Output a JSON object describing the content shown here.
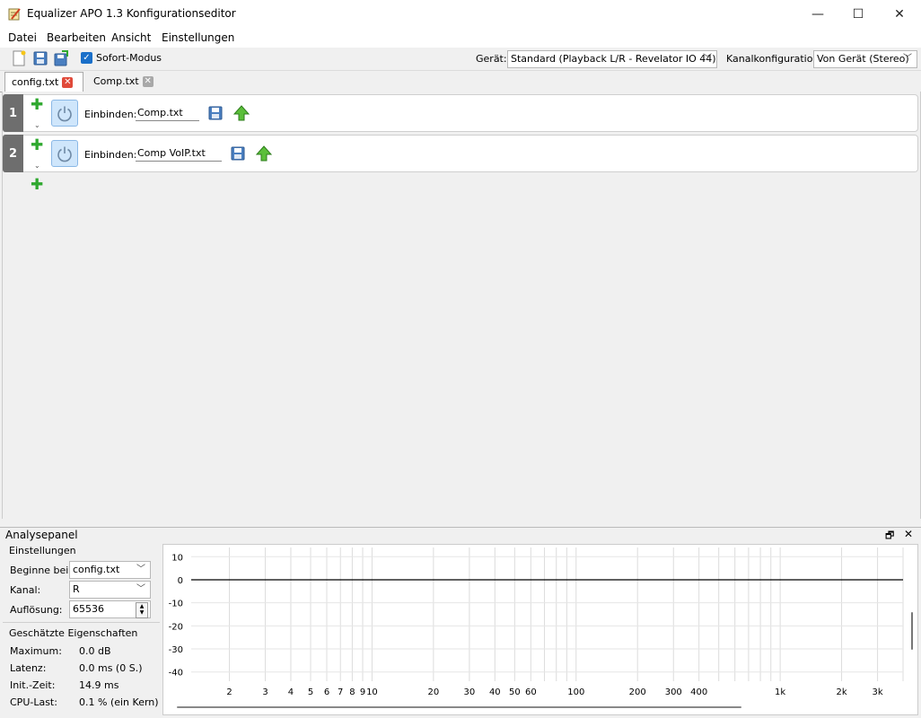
{
  "window": {
    "title": "Equalizer APO 1.3 Konfigurationseditor",
    "minimize_glyph": "—",
    "maximize_glyph": "☐",
    "close_glyph": "✕"
  },
  "menu": [
    "Datei",
    "Bearbeiten",
    "Ansicht",
    "Einstellungen"
  ],
  "toolbar": {
    "icons": [
      "new-file-icon",
      "save-icon",
      "save-all-icon"
    ],
    "instant_mode_label": "Sofort-Modus",
    "instant_mode_checked": true,
    "device_label": "Gerät:",
    "device_value": "Standard (Playback L/R - Revelator IO 44)",
    "channel_config_label": "Kanalkonfiguration:",
    "channel_config_value": "Von Gerät (Stereo)"
  },
  "tabs": [
    {
      "label": "config.txt",
      "active": true
    },
    {
      "label": "Comp.txt",
      "active": false
    }
  ],
  "filters": [
    {
      "number": "1",
      "include_label": "Einbinden:",
      "file": "Comp.txt"
    },
    {
      "number": "2",
      "include_label": "Einbinden:",
      "file": "Comp VoIP.txt"
    }
  ],
  "analysis": {
    "title": "Analysepanel",
    "settings_group": "Einstellungen",
    "start_at_label": "Beginne bei:",
    "start_at_value": "config.txt",
    "channel_label": "Kanal:",
    "channel_value": "R",
    "resolution_label": "Auflösung:",
    "resolution_value": "65536",
    "estimated_group": "Geschätzte Eigenschaften",
    "properties": [
      {
        "label": "Maximum:",
        "value": "0.0 dB"
      },
      {
        "label": "Latenz:",
        "value": "0.0 ms (0 S.)"
      },
      {
        "label": "Init.-Zeit:",
        "value": "14.9 ms"
      },
      {
        "label": "CPU-Last:",
        "value": "0.1 % (ein Kern)"
      }
    ]
  },
  "chart_data": {
    "type": "line",
    "x_scale": "log",
    "xlim": [
      1.3,
      4000
    ],
    "ylim": [
      -44,
      14
    ],
    "yticks": [
      "10",
      "0",
      "-10",
      "-20",
      "-30",
      "-40"
    ],
    "xtick_labels": [
      "2",
      "3",
      "4",
      "5",
      "6",
      "7",
      "8",
      "9",
      "10",
      "20",
      "30",
      "40",
      "50",
      "60",
      "100",
      "200",
      "300",
      "400",
      "1k",
      "2k",
      "3k"
    ],
    "grid": true,
    "series": [
      {
        "x": [
          1.3,
          4000
        ],
        "y": [
          0,
          0
        ]
      }
    ]
  },
  "colors": {
    "plus_green": "#2fa82f",
    "power_blue": "#cfe6fb",
    "tab_close_red": "#e04a3a",
    "tab_close_gray": "#a8a8a8",
    "checkbox_blue": "#1a6fc9"
  }
}
